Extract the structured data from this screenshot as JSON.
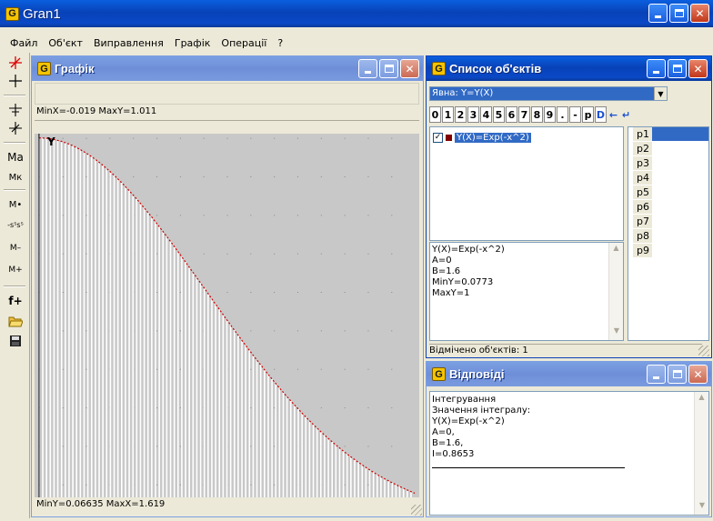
{
  "app": {
    "title": "Gran1",
    "logo_letter": "G"
  },
  "menu": [
    "Файл",
    "Об'єкт",
    "Виправлення",
    "Графік",
    "Операції",
    "?"
  ],
  "toolbar": {
    "tools": [
      "axes-tool",
      "cross-tool",
      "point-tool",
      "segment-tool",
      "ma-tool",
      "mk-tool",
      "mdot-tool",
      "sss-tool",
      "m-minus-tool",
      "m-plus-tool",
      "f-plus-tool",
      "open-folder-tool",
      "save-tool"
    ],
    "labels": {
      "ma": "Ma",
      "mk": "Mк",
      "mdot": "M•",
      "sss": "-s⁵s⁵",
      "m_minus": "M–",
      "m_plus": "M+",
      "f_plus": "f+"
    }
  },
  "graph_window": {
    "title": "Графік",
    "top_status": "MinX=-0.019  MaxY=1.011",
    "bottom_status": "MinY=0.06635  MaxX=1.619",
    "y_axis_label": "Y",
    "function": "exp(-x^2)",
    "x_range": [
      -0.019,
      1.619
    ],
    "y_range": [
      0.06635,
      1.011
    ],
    "integration_limits": [
      0,
      1.6
    ],
    "fill_colors": {
      "bars": "#ffffff",
      "curve": "#cc0000",
      "background": "#c8c8c8"
    }
  },
  "objects_window": {
    "title": "Список об'єктів",
    "dropdown_value": "Явна: Y=Y(X)",
    "keypad": [
      "0",
      "1",
      "2",
      "3",
      "4",
      "5",
      "6",
      "7",
      "8",
      "9",
      ".",
      "-",
      "p",
      "D",
      "←",
      "↵"
    ],
    "objects": [
      {
        "label": "Y(X)=Exp(-x^2)",
        "checked": true,
        "color": "#800000"
      }
    ],
    "params": [
      "p1",
      "p2",
      "p3",
      "p4",
      "p5",
      "p6",
      "p7",
      "p8",
      "p9"
    ],
    "details": [
      "Y(X)=Exp(-x^2)",
      "A=0",
      "B=1.6",
      "MinY=0.0773",
      "MaxY=1"
    ],
    "status": "Відмічено об'єктів: 1"
  },
  "answers_window": {
    "title": "Відповіді",
    "lines": [
      "Інтегрування",
      "Значення інтегралу:",
      "Y(X)=Exp(-x^2)",
      "A=0,",
      "B=1.6,",
      "I=0.8653"
    ]
  },
  "colors": {
    "title_active": "#0a48c6",
    "title_inactive": "#7b9fe2",
    "selection": "#316ac5",
    "window_bg": "#ece9d8"
  }
}
